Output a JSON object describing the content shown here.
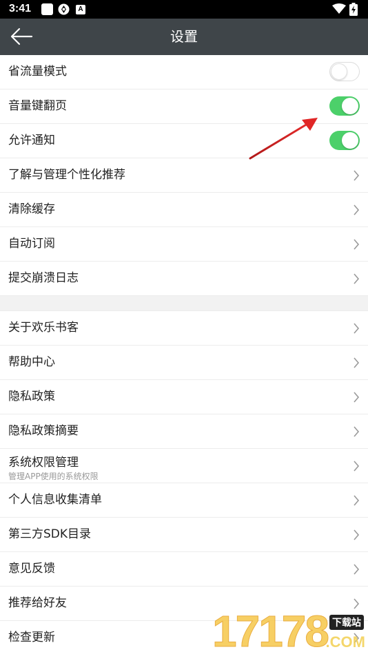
{
  "status_bar": {
    "time": "3:41",
    "icons": [
      "app-square-icon",
      "vpn-circle-icon",
      "a-letter-icon",
      "wifi-icon",
      "battery-charging-icon"
    ],
    "a_icon_text": "A"
  },
  "app_bar": {
    "title": "设置",
    "back_icon": "back-arrow-icon",
    "background": "#3f4549"
  },
  "group1": [
    {
      "label": "省流量模式",
      "control": "toggle",
      "on": false
    },
    {
      "label": "音量键翻页",
      "control": "toggle",
      "on": true
    },
    {
      "label": "允许通知",
      "control": "toggle",
      "on": true
    },
    {
      "label": "了解与管理个性化推荐",
      "control": "chevron"
    },
    {
      "label": "清除缓存",
      "control": "chevron"
    },
    {
      "label": "自动订阅",
      "control": "chevron"
    },
    {
      "label": "提交崩溃日志",
      "control": "chevron"
    }
  ],
  "group2": [
    {
      "label": "关于欢乐书客",
      "control": "chevron"
    },
    {
      "label": "帮助中心",
      "control": "chevron"
    },
    {
      "label": "隐私政策",
      "control": "chevron"
    },
    {
      "label": "隐私政策摘要",
      "control": "chevron"
    },
    {
      "label": "系统权限管理",
      "sublabel": "管理APP使用的系统权限",
      "control": "chevron"
    },
    {
      "label": "个人信息收集清单",
      "control": "chevron"
    },
    {
      "label": "第三方SDK目录",
      "control": "chevron"
    },
    {
      "label": "意见反馈",
      "control": "chevron"
    },
    {
      "label": "推荐给好友",
      "control": "chevron"
    },
    {
      "label": "检查更新",
      "control": "chevron"
    }
  ],
  "colors": {
    "toggle_on": "#4cd06a",
    "annotation_arrow": "#d9201f",
    "divider": "#ececec",
    "section_gap": "#f2f2f2"
  },
  "watermark": {
    "digits": "17178",
    "badge": "下载站",
    "domain": ".COM"
  }
}
